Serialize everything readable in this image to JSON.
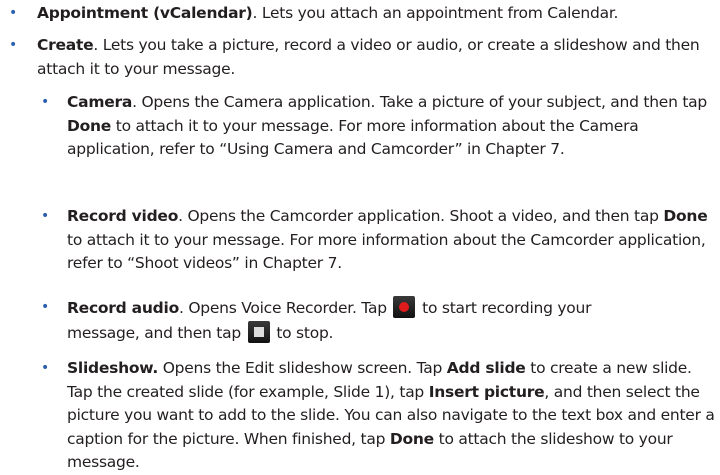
{
  "items": [
    {
      "term": "Appointment (vCalendar)",
      "text": ". Lets you attach an appointment from Calendar."
    },
    {
      "term": "Create",
      "text": ". Lets you take a picture, record a video or audio, or create a slideshow and then attach it to your message."
    }
  ],
  "subitems": {
    "camera": {
      "term": "Camera",
      "text_1": ". Opens the Camera application. Take a picture of your subject, and then tap ",
      "done": "Done",
      "text_2": " to attach it to your message. For more information about the Camera application, refer to “Using Camera and Camcorder” in Chapter 7."
    },
    "record_video": {
      "term": "Record video",
      "text_1": ". Opens the Camcorder application. Shoot a video, and then tap ",
      "done": "Done",
      "text_2": " to attach it to your message. For more information about the Camcorder application, refer to “Shoot videos” in Chapter 7."
    },
    "record_audio": {
      "term": "Record audio",
      "text_1": ". Opens Voice Recorder. Tap ",
      "text_2": " to start recording your message, and then tap ",
      "text_3": " to stop.",
      "record_icon": "record-icon",
      "stop_icon": "stop-icon"
    },
    "slideshow": {
      "term": "Slideshow.",
      "text_1": " Opens the Edit slideshow screen. Tap ",
      "add_slide": "Add slide",
      "text_2": " to create a new slide. Tap the created slide (for example, Slide 1), tap ",
      "insert_picture": "Insert picture",
      "text_3": ", and then select the picture you want to add to the slide. You can also navigate to the text box and enter a caption for the picture. When finished, tap ",
      "done": "Done",
      "text_4": " to attach the slideshow to your message."
    }
  },
  "bullet_glyph": "•",
  "colors": {
    "bullet": "#2b5fae",
    "text": "#231f20",
    "record_dot": "#e01b1b"
  }
}
